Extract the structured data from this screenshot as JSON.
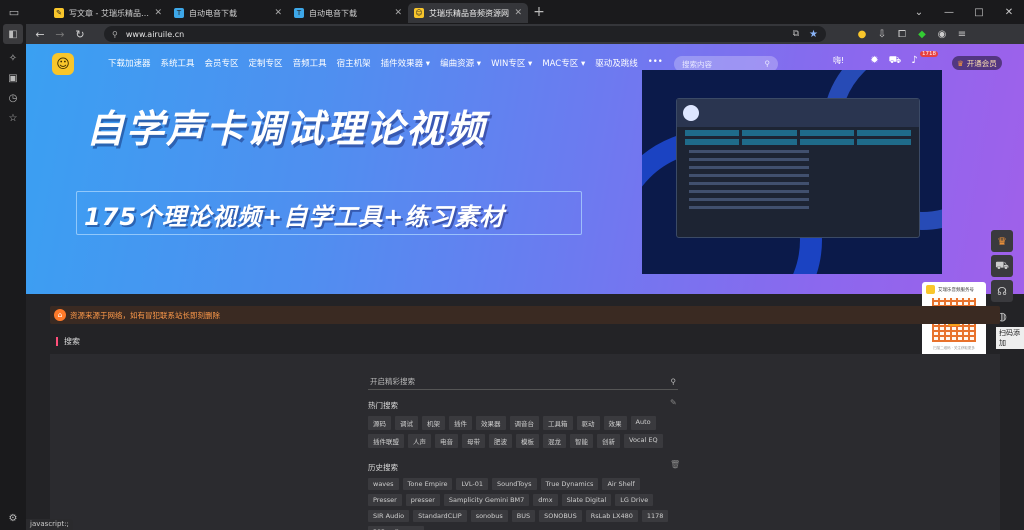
{
  "tabs": [
    {
      "title": "写文章 - 艾瑞乐精品音频资源网",
      "color": "#f9c62b",
      "glyph": "✎",
      "active": false
    },
    {
      "title": "自动电音下载",
      "color": "#3da7e8",
      "glyph": "T",
      "active": false
    },
    {
      "title": "自动电音下载",
      "color": "#3da7e8",
      "glyph": "T",
      "active": false
    },
    {
      "title": "艾瑞乐精品音频资源网",
      "color": "#f9c62b",
      "glyph": "☺",
      "active": true
    }
  ],
  "address": {
    "url": "www.airuile.cn"
  },
  "status_text": "javascript:;",
  "site": {
    "nav": [
      "下载加速器",
      "系统工具",
      "会员专区",
      "定制专区",
      "音频工具",
      "宿主机架",
      "插件效果器 ▾",
      "编曲资源 ▾",
      "WIN专区 ▾",
      "MAC专区 ▾",
      "驱动及跳线",
      "•••"
    ],
    "search_placeholder": "搜索内容",
    "user_greeting": "嗨!",
    "badge": "1718",
    "vip_label": "开通会员",
    "banner_title": "自学声卡调试理论视频",
    "banner_subtitle": "175个理论视频+自学工具+练习素材"
  },
  "notice": "资源来源于网络，如有冒犯联系站长即刻删除",
  "section_title": "搜索",
  "search": {
    "placeholder": "开启精彩搜索",
    "hot_label": "热门搜索",
    "hot": [
      "源码",
      "调试",
      "机架",
      "插件",
      "效果器",
      "调音台",
      "工具箱",
      "驱动",
      "效果",
      "Auto",
      "插件联盟",
      "人声",
      "电音",
      "母带",
      "肥波",
      "模板",
      "混龙",
      "智能",
      "创新",
      "Vocal EQ"
    ],
    "history_label": "历史搜索",
    "history": [
      "waves",
      "Tone Empire",
      "LVL-01",
      "SoundToys",
      "True Dynamics",
      "Air Shelf",
      "Presser",
      "presser",
      "Samplicity Gemini BM7",
      "dmx",
      "Slate Digital",
      "LG Drive",
      "SIR Audio",
      "StandardCLIP",
      "sonobus",
      "BUS",
      "SONOBUS",
      "RsLab LX480",
      "1178",
      "PSPaudioware"
    ]
  },
  "qr_card": {
    "title": "艾瑞乐音频服务号",
    "footer": "扫描二维码 · 关注获取更多"
  },
  "tooltip": "扫码添加"
}
